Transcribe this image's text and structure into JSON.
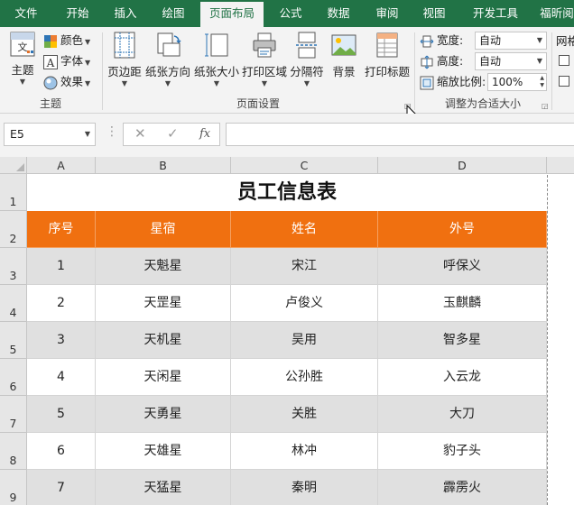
{
  "tabs": [
    "文件",
    "开始",
    "插入",
    "绘图",
    "页面布局",
    "公式",
    "数据",
    "审阅",
    "视图",
    "开发工具",
    "福昕阅"
  ],
  "active_tab": "页面布局",
  "ribbon": {
    "theme_group": {
      "label": "主题",
      "theme_button": "主题",
      "colors": "颜色",
      "fonts": "字体",
      "effects": "效果"
    },
    "page_setup_group": {
      "label": "页面设置",
      "margins": "页边距",
      "orientation": "纸张方向",
      "size": "纸张大小",
      "print_area": "打印区域",
      "breaks": "分隔符",
      "background": "背景",
      "print_titles": "打印标题"
    },
    "scale_group": {
      "label": "调整为合适大小",
      "width_label": "宽度:",
      "width_value": "自动",
      "height_label": "高度:",
      "height_value": "自动",
      "scale_label": "缩放比例:",
      "scale_value": "100%"
    },
    "sheet_options_group": {
      "label_partial": "网格"
    }
  },
  "formula_bar": {
    "name_box": "E5",
    "cancel_symbol": "✕",
    "enter_symbol": "✓",
    "fx_symbol": "fx",
    "value": ""
  },
  "columns": [
    "A",
    "B",
    "C",
    "D"
  ],
  "rows": [
    "1",
    "2",
    "3",
    "4",
    "5",
    "6",
    "7",
    "8",
    "9"
  ],
  "sheet": {
    "title": "员工信息表",
    "headers": [
      "序号",
      "星宿",
      "姓名",
      "外号"
    ],
    "records": [
      [
        "1",
        "天魁星",
        "宋江",
        "呼保义"
      ],
      [
        "2",
        "天罡星",
        "卢俊义",
        "玉麒麟"
      ],
      [
        "3",
        "天机星",
        "吴用",
        "智多星"
      ],
      [
        "4",
        "天闲星",
        "公孙胜",
        "入云龙"
      ],
      [
        "5",
        "天勇星",
        "关胜",
        "大刀"
      ],
      [
        "6",
        "天雄星",
        "林冲",
        "豹子头"
      ],
      [
        "7",
        "天猛星",
        "秦明",
        "霹雳火"
      ]
    ]
  },
  "colors": {
    "tab_bar": "#217346",
    "header_fill": "#f07010",
    "stripe_fill": "#e0e0e0",
    "white": "#ffffff"
  }
}
